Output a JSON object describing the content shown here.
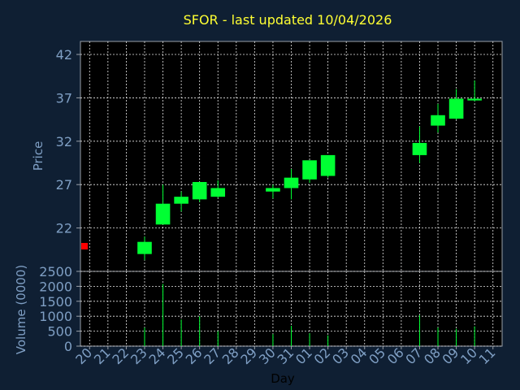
{
  "chart_title": "SFOR - last updated 10/04/2026",
  "colors": {
    "up": "#00ff33",
    "down": "#ff0000",
    "title": "#ffff33",
    "axis_text": "#7f9fc4",
    "background": "#0f1f33",
    "plot_bg": "#000000"
  },
  "chart_data": [
    {
      "type": "candlestick",
      "ylabel": "Price",
      "ylim": [
        17,
        43.5
      ],
      "yticks": [
        "42",
        "37",
        "32",
        "27",
        "22"
      ],
      "grid": true,
      "x": [
        "20",
        "21",
        "22",
        "23",
        "24",
        "25",
        "26",
        "27",
        "28",
        "29",
        "30",
        "31",
        "01",
        "02",
        "03",
        "04",
        "05",
        "06",
        "07",
        "08",
        "09",
        "10",
        "11"
      ],
      "candles": [
        {
          "x": "20",
          "open": 19.9,
          "close": 19.9,
          "high": 19.9,
          "low": 19.9,
          "dir": "down"
        },
        {
          "x": "23",
          "open": 19.0,
          "close": 20.4,
          "high": 21.0,
          "low": 18.3,
          "dir": "up"
        },
        {
          "x": "24",
          "open": 22.4,
          "close": 24.8,
          "high": 27.0,
          "low": 22.4,
          "dir": "up"
        },
        {
          "x": "25",
          "open": 24.8,
          "close": 25.6,
          "high": 26.2,
          "low": 23.9,
          "dir": "up"
        },
        {
          "x": "26",
          "open": 25.3,
          "close": 27.3,
          "high": 27.3,
          "low": 25.0,
          "dir": "up"
        },
        {
          "x": "27",
          "open": 25.6,
          "close": 26.6,
          "high": 27.5,
          "low": 25.5,
          "dir": "up"
        },
        {
          "x": "30",
          "open": 26.2,
          "close": 26.6,
          "high": 27.0,
          "low": 25.4,
          "dir": "up"
        },
        {
          "x": "31",
          "open": 26.6,
          "close": 27.8,
          "high": 28.8,
          "low": 25.3,
          "dir": "up"
        },
        {
          "x": "01",
          "open": 27.6,
          "close": 29.8,
          "high": 29.8,
          "low": 27.2,
          "dir": "up"
        },
        {
          "x": "02",
          "open": 28.0,
          "close": 30.4,
          "high": 30.4,
          "low": 27.8,
          "dir": "up"
        },
        {
          "x": "07",
          "open": 30.4,
          "close": 31.8,
          "high": 33.7,
          "low": 29.5,
          "dir": "up"
        },
        {
          "x": "08",
          "open": 33.8,
          "close": 35.0,
          "high": 36.3,
          "low": 33.0,
          "dir": "up"
        },
        {
          "x": "09",
          "open": 34.6,
          "close": 36.9,
          "high": 38.0,
          "low": 34.5,
          "dir": "up"
        },
        {
          "x": "10",
          "open": 36.7,
          "close": 36.9,
          "high": 39.0,
          "low": 36.6,
          "dir": "up"
        }
      ]
    },
    {
      "type": "bar",
      "ylabel": "Volume (0000)",
      "xlabel": "Day",
      "ylim": [
        0,
        2500
      ],
      "yticks": [
        "2500",
        "2000",
        "1500",
        "1000",
        "500",
        "0"
      ],
      "grid": true,
      "x": [
        "20",
        "21",
        "22",
        "23",
        "24",
        "25",
        "26",
        "27",
        "28",
        "29",
        "30",
        "31",
        "01",
        "02",
        "03",
        "04",
        "05",
        "06",
        "07",
        "08",
        "09",
        "10",
        "11"
      ],
      "values": [
        0,
        0,
        0,
        620,
        2080,
        890,
        1000,
        500,
        0,
        0,
        400,
        680,
        430,
        360,
        0,
        0,
        0,
        0,
        1040,
        620,
        580,
        660,
        0
      ]
    }
  ]
}
